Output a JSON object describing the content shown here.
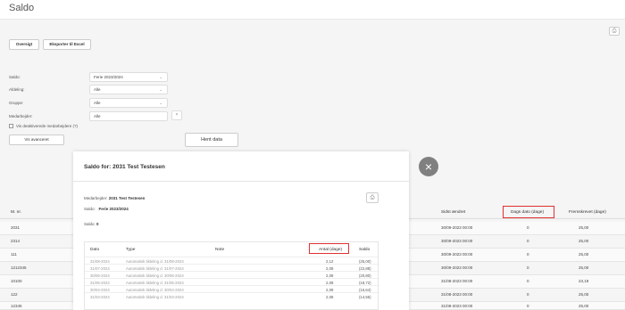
{
  "page": {
    "title": "Saldo"
  },
  "toolbar": {
    "overview_label": "Oversigt",
    "export_label": "Eksporter til Excel",
    "print_icon": "print-icon"
  },
  "filters": [
    {
      "label": "Saldo:",
      "value": "Ferie 2023/2024",
      "kind": "select"
    },
    {
      "label": "Afdeling:",
      "value": "Alle",
      "kind": "select"
    },
    {
      "label": "Gruppe:",
      "value": "Alle",
      "kind": "select"
    },
    {
      "label": "Medarbejder:",
      "value": "Alle",
      "kind": "input"
    }
  ],
  "filter_extras": {
    "clear_symbol": "×",
    "show_deactivated_label": "Vis deaktiverede medarbejdere (?)",
    "advanced_label": "Vis avanceret",
    "fetch_label": "Hent data"
  },
  "table": {
    "headers": {
      "mnr": "M. nr.",
      "last_changed": "Sidst ændret",
      "days_date": "Dags dato (dage)",
      "forwarded": "Fremskrevet (dage)"
    },
    "rows": [
      {
        "mnr": "2031",
        "last_changed": "30/09-2023 00:00",
        "days_date": "0",
        "forwarded": "25,00"
      },
      {
        "mnr": "2314",
        "last_changed": "30/09-2023 00:00",
        "days_date": "0",
        "forwarded": "25,00"
      },
      {
        "mnr": "111",
        "last_changed": "30/09-2023 00:00",
        "days_date": "0",
        "forwarded": "25,00"
      },
      {
        "mnr": "1212345",
        "last_changed": "30/09-2023 00:00",
        "days_date": "0",
        "forwarded": "25,00"
      },
      {
        "mnr": "10100",
        "last_changed": "31/08-2023 00:00",
        "days_date": "0",
        "forwarded": "23,19"
      },
      {
        "mnr": "122",
        "last_changed": "31/08-2023 00:00",
        "days_date": "0",
        "forwarded": "25,00"
      },
      {
        "mnr": "12345",
        "last_changed": "31/08-2023 00:00",
        "days_date": "0",
        "forwarded": "25,00"
      }
    ]
  },
  "modal": {
    "title": "Saldo for: 2031 Test Testesen",
    "employee_label": "Medarbejder:",
    "employee_value": "2031 Test Testesen",
    "saldo_label": "Saldo:",
    "saldo_value": "Ferie 2023/2024",
    "balance_label": "Saldo:",
    "balance_value": "0",
    "close_symbol": "×",
    "headers": {
      "date": "Dato",
      "type": "Type",
      "note": "Note",
      "count": "Antal (dage)",
      "saldo": "Saldo"
    },
    "rows": [
      {
        "date": "31/08-2024",
        "type": "Automatisk tildeling d. 31/08-2024",
        "note": "",
        "count": "2,12",
        "saldo": "(25,00)"
      },
      {
        "date": "31/07-2024",
        "type": "Automatisk tildeling d. 31/07-2024",
        "note": "",
        "count": "2,08",
        "saldo": "(22,88)"
      },
      {
        "date": "30/06-2024",
        "type": "Automatisk tildeling d. 30/06-2024",
        "note": "",
        "count": "2,08",
        "saldo": "(20,80)"
      },
      {
        "date": "31/05-2024",
        "type": "Automatisk tildeling d. 31/05-2024",
        "note": "",
        "count": "2,08",
        "saldo": "(18,72)"
      },
      {
        "date": "30/04-2024",
        "type": "Automatisk tildeling d. 30/04-2024",
        "note": "",
        "count": "2,08",
        "saldo": "(16,64)"
      },
      {
        "date": "31/03-2024",
        "type": "Automatisk tildeling d. 31/03-2024",
        "note": "",
        "count": "2,08",
        "saldo": "(14,56)"
      }
    ]
  },
  "colors": {
    "highlight": "#e03030",
    "close_button": "#808080"
  }
}
